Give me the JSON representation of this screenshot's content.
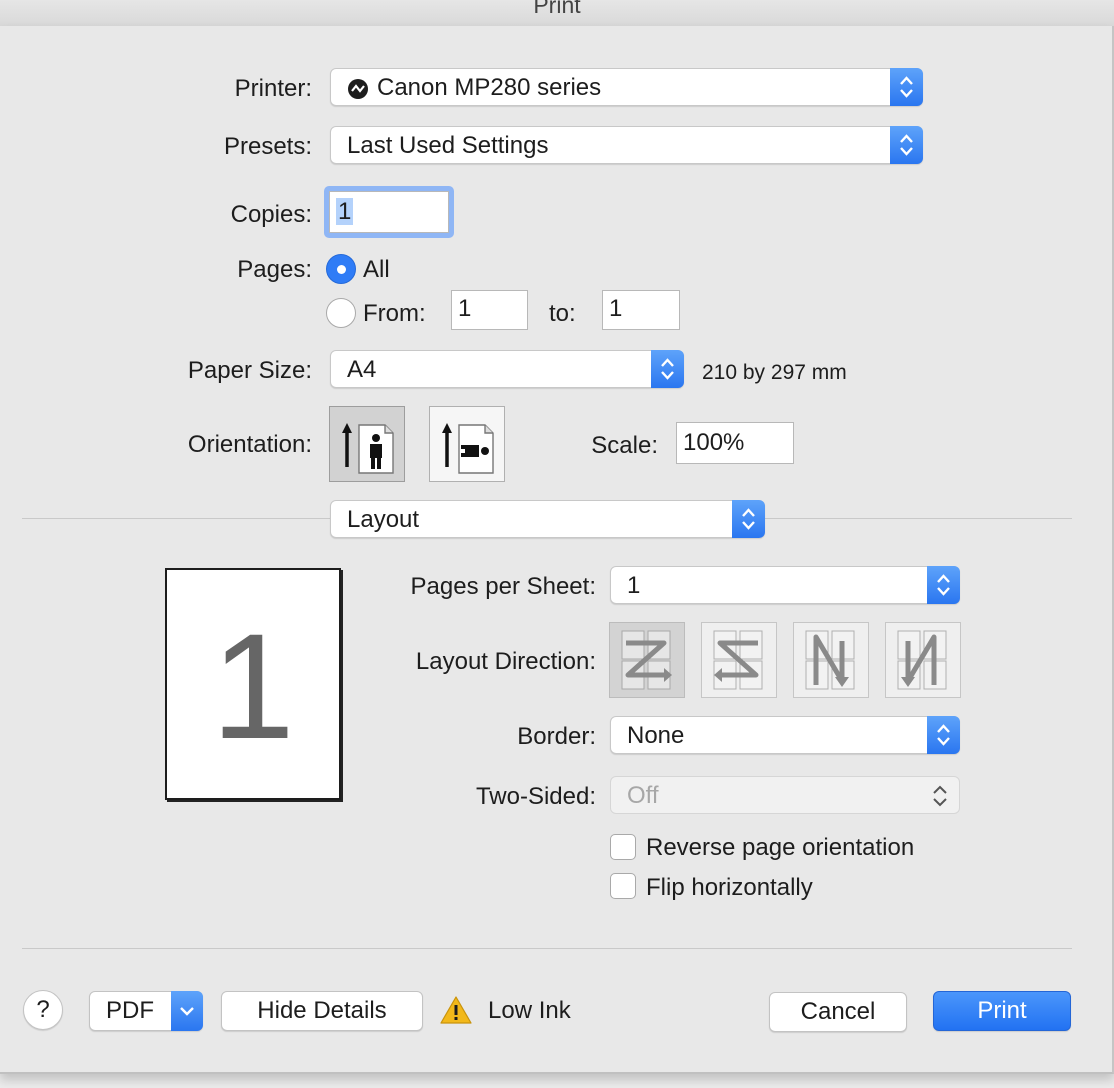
{
  "window": {
    "title": "Print"
  },
  "printer": {
    "label": "Printer:",
    "value": "Canon MP280 series"
  },
  "presets": {
    "label": "Presets:",
    "value": "Last Used Settings"
  },
  "copies": {
    "label": "Copies:",
    "value": "1"
  },
  "pages": {
    "label": "Pages:",
    "all_label": "All",
    "all_selected": true,
    "from_label": "From:",
    "from_value": "1",
    "to_label": "to:",
    "to_value": "1"
  },
  "paper_size": {
    "label": "Paper Size:",
    "value": "A4",
    "dimensions": "210 by 297 mm"
  },
  "orientation": {
    "label": "Orientation:",
    "selected": "portrait"
  },
  "scale": {
    "label": "Scale:",
    "value": "100%"
  },
  "section": {
    "value": "Layout"
  },
  "preview": {
    "page_number": "1"
  },
  "layout": {
    "pages_per_sheet_label": "Pages per Sheet:",
    "pages_per_sheet_value": "1",
    "direction_label": "Layout Direction:",
    "border_label": "Border:",
    "border_value": "None",
    "two_sided_label": "Two-Sided:",
    "two_sided_value": "Off",
    "reverse_label": "Reverse page orientation",
    "flip_label": "Flip horizontally"
  },
  "footer": {
    "help": "?",
    "pdf": "PDF",
    "hide_details": "Hide Details",
    "low_ink": "Low Ink",
    "cancel": "Cancel",
    "print": "Print"
  },
  "colors": {
    "accent": "#2f7cf6",
    "warning": "#f2b81a"
  }
}
